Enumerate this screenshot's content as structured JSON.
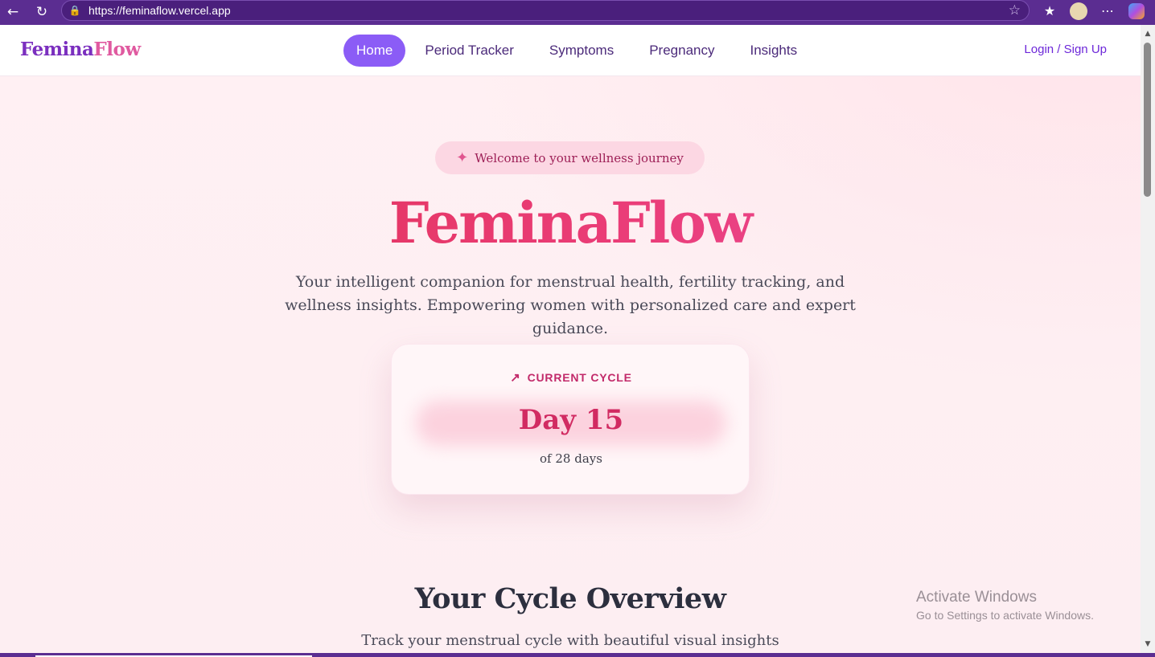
{
  "browser": {
    "url": "https://feminaflow.vercel.app"
  },
  "nav": {
    "brand_part1": "Femina",
    "brand_part2": "Flow",
    "links": [
      "Home",
      "Period Tracker",
      "Symptoms",
      "Pregnancy",
      "Insights"
    ],
    "active_index": 0,
    "login": "Login / Sign Up"
  },
  "hero": {
    "badge": "Welcome to your wellness journey",
    "title": "FeminaFlow",
    "subtitle": "Your intelligent companion for menstrual health, fertility tracking, and wellness insights. Empowering women with personalized care and expert guidance."
  },
  "cycle": {
    "label": "CURRENT CYCLE",
    "day": "Day 15",
    "of_days": "of 28 days"
  },
  "overview": {
    "title": "Your Cycle Overview",
    "subtitle": "Track your menstrual cycle with beautiful visual insights"
  },
  "windows_notice": {
    "line1": "Activate Windows",
    "line2": "Go to Settings to activate Windows."
  },
  "colors": {
    "accent_purple": "#8b5cf6",
    "brand_purple": "#7b2fbf",
    "brand_pink": "#e05aa0",
    "cycle_red": "#d12b62"
  },
  "icons": {
    "back": "arrow-left-icon",
    "reload": "reload-icon",
    "lock": "lock-icon",
    "favorite": "star-icon",
    "badge": "sparkles-icon",
    "cycle": "trending-up-icon"
  }
}
